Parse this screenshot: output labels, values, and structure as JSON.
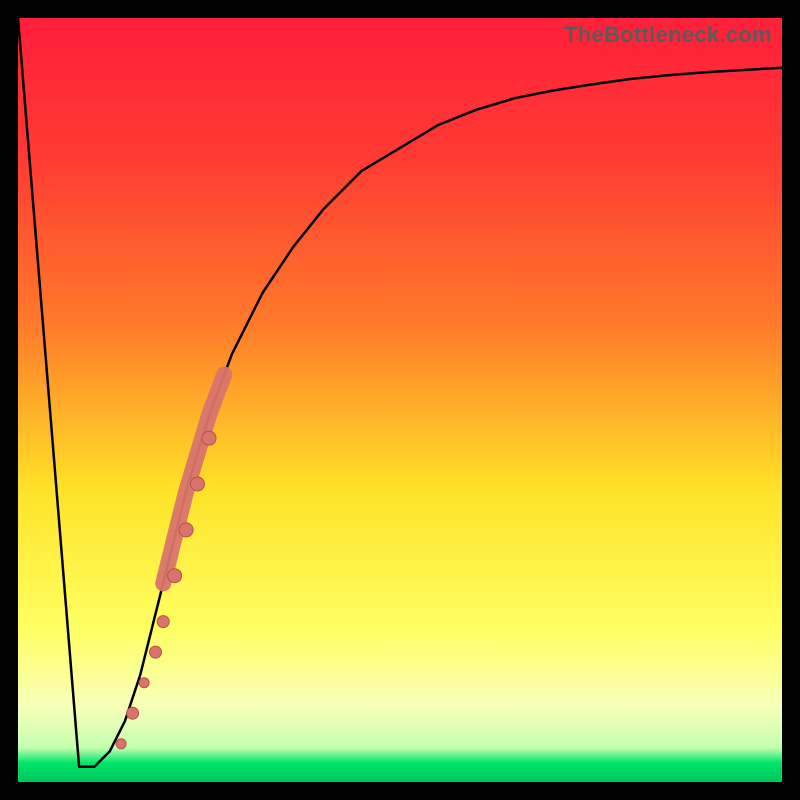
{
  "watermark": "TheBottleneck.com",
  "colors": {
    "frame": "#000000",
    "gradient_top": "#ff1f3a",
    "gradient_mid1": "#ff7a2a",
    "gradient_mid2": "#ffe328",
    "gradient_pale": "#f8ffb8",
    "gradient_green": "#00e56a",
    "curve": "#000000",
    "marker_fill": "#d9746c",
    "marker_stroke": "#b94f48"
  },
  "chart_data": {
    "type": "line",
    "title": "",
    "xlabel": "",
    "ylabel": "",
    "xlim": [
      0,
      100
    ],
    "ylim": [
      0,
      100
    ],
    "series": [
      {
        "name": "bottleneck-curve",
        "x": [
          0,
          8,
          10,
          12,
          14,
          16,
          18,
          20,
          22,
          25,
          28,
          32,
          36,
          40,
          45,
          50,
          55,
          60,
          65,
          70,
          75,
          80,
          85,
          90,
          95,
          100
        ],
        "values": [
          100,
          2,
          2,
          4,
          8,
          14,
          22,
          30,
          38,
          48,
          56,
          64,
          70,
          75,
          80,
          83,
          86,
          88,
          89.5,
          90.5,
          91.3,
          92,
          92.5,
          92.9,
          93.2,
          93.5
        ]
      }
    ],
    "markers": [
      {
        "x": 13.5,
        "y": 5,
        "r": 5
      },
      {
        "x": 15.0,
        "y": 9,
        "r": 6
      },
      {
        "x": 16.5,
        "y": 13,
        "r": 5
      },
      {
        "x": 18.0,
        "y": 17,
        "r": 6
      },
      {
        "x": 19.0,
        "y": 21,
        "r": 6
      },
      {
        "x": 20.5,
        "y": 27,
        "r": 7
      },
      {
        "x": 22.0,
        "y": 33,
        "r": 7
      },
      {
        "x": 23.5,
        "y": 39,
        "r": 7
      },
      {
        "x": 25.0,
        "y": 45,
        "r": 7
      }
    ]
  }
}
